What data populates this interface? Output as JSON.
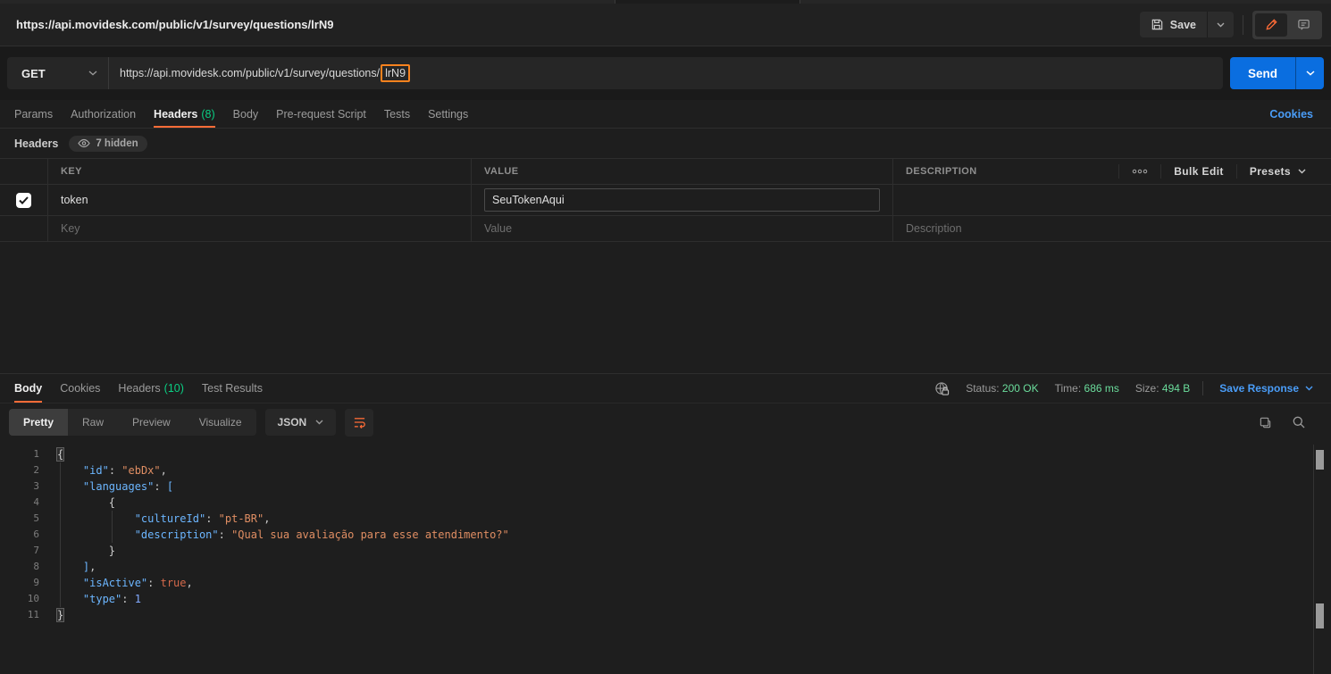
{
  "titlebar": {
    "title": "https://api.movidesk.com/public/v1/survey/questions/lrN9",
    "save_label": "Save"
  },
  "request": {
    "method": "GET",
    "url_prefix": "https://api.movidesk.com/public/v1/survey/questions/",
    "url_highlight": "lrN9",
    "send_label": "Send",
    "tabs": [
      {
        "label": "Params"
      },
      {
        "label": "Authorization"
      },
      {
        "label": "Headers",
        "count": "(8)",
        "active": true
      },
      {
        "label": "Body"
      },
      {
        "label": "Pre-request Script"
      },
      {
        "label": "Tests"
      },
      {
        "label": "Settings"
      }
    ],
    "cookies_link": "Cookies"
  },
  "headers_section": {
    "title": "Headers",
    "hidden_badge": "7 hidden",
    "columns": {
      "key": "KEY",
      "value": "VALUE",
      "description": "DESCRIPTION"
    },
    "controls": {
      "more": "ooo",
      "bulk_edit": "Bulk Edit",
      "presets": "Presets"
    },
    "row": {
      "key": "token",
      "value": "SeuTokenAqui",
      "description": "",
      "checked": true
    },
    "placeholder_row": {
      "key": "Key",
      "value": "Value",
      "description": "Description"
    }
  },
  "response": {
    "tabs": [
      {
        "label": "Body",
        "active": true
      },
      {
        "label": "Cookies"
      },
      {
        "label": "Headers",
        "count": "(10)"
      },
      {
        "label": "Test Results"
      }
    ],
    "meta": {
      "status_label": "Status:",
      "status_value": "200 OK",
      "time_label": "Time:",
      "time_value": "686 ms",
      "size_label": "Size:",
      "size_value": "494 B",
      "save_response": "Save Response"
    },
    "view_tabs": [
      {
        "label": "Pretty",
        "active": true
      },
      {
        "label": "Raw"
      },
      {
        "label": "Preview"
      },
      {
        "label": "Visualize"
      }
    ],
    "format": "JSON",
    "code_lines": [
      [
        [
          "bm",
          "{"
        ]
      ],
      [
        [
          "ws",
          "    "
        ],
        [
          "k",
          "\"id\""
        ],
        [
          "p",
          ": "
        ],
        [
          "s",
          "\"ebDx\""
        ],
        [
          "p",
          ","
        ]
      ],
      [
        [
          "ws",
          "    "
        ],
        [
          "k",
          "\"languages\""
        ],
        [
          "p",
          ": "
        ],
        [
          "arr",
          "["
        ]
      ],
      [
        [
          "ws",
          "        "
        ],
        [
          "b",
          "{"
        ]
      ],
      [
        [
          "ws",
          "            "
        ],
        [
          "k",
          "\"cultureId\""
        ],
        [
          "p",
          ": "
        ],
        [
          "s",
          "\"pt-BR\""
        ],
        [
          "p",
          ","
        ]
      ],
      [
        [
          "ws",
          "            "
        ],
        [
          "k",
          "\"description\""
        ],
        [
          "p",
          ": "
        ],
        [
          "s",
          "\"Qual sua avaliação para esse atendimento?\""
        ]
      ],
      [
        [
          "ws",
          "        "
        ],
        [
          "b",
          "}"
        ]
      ],
      [
        [
          "ws",
          "    "
        ],
        [
          "arr",
          "]"
        ],
        [
          "p",
          ","
        ]
      ],
      [
        [
          "ws",
          "    "
        ],
        [
          "k",
          "\"isActive\""
        ],
        [
          "p",
          ": "
        ],
        [
          "bool",
          "true"
        ],
        [
          "p",
          ","
        ]
      ],
      [
        [
          "ws",
          "    "
        ],
        [
          "k",
          "\"type\""
        ],
        [
          "p",
          ": "
        ],
        [
          "n",
          "1"
        ]
      ],
      [
        [
          "bm",
          "}"
        ]
      ]
    ],
    "accent_orange": "#ff6c37",
    "status_green": "#0acf83",
    "link_blue": "#4a9df8"
  }
}
